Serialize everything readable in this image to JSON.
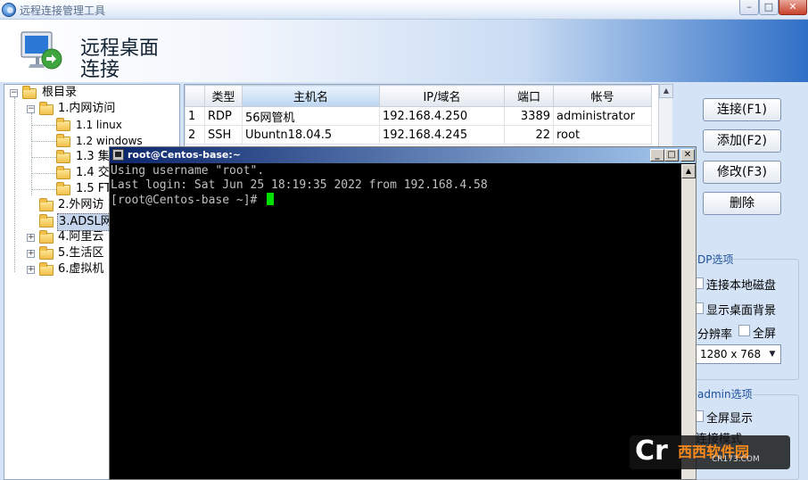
{
  "window": {
    "title": "远程连接管理工具",
    "min": "–",
    "max": "□",
    "close": "✕"
  },
  "banner": {
    "line1": "远程桌面",
    "line2": "连接"
  },
  "tree": {
    "root": "根目录",
    "nodes": [
      {
        "label": "1.内网访问",
        "expander": "−"
      },
      {
        "label": "1.1 linux"
      },
      {
        "label": "1.2 windows"
      },
      {
        "label": "1.3 集"
      },
      {
        "label": "1.4 交"
      },
      {
        "label": "1.5 FT"
      },
      {
        "label": "2.外网访"
      },
      {
        "label": "3.ADSL网"
      },
      {
        "label": "4.阿里云",
        "expander": "+"
      },
      {
        "label": "5.生活区",
        "expander": "+"
      },
      {
        "label": "6.虚拟机",
        "expander": "+"
      }
    ],
    "root_expander": "−"
  },
  "table": {
    "headers": [
      "",
      "类型",
      "主机名",
      "IP/域名",
      "端口",
      "帐号"
    ],
    "rows": [
      {
        "idx": "1",
        "type": "RDP",
        "host": "56网管机",
        "ip": "192.168.4.250",
        "port": "3389",
        "account": "administrator"
      },
      {
        "idx": "2",
        "type": "SSH",
        "host": "Ubuntn18.04.5",
        "ip": "192.168.4.245",
        "port": "22",
        "account": "root"
      }
    ]
  },
  "buttons": {
    "connect": "连接(F1)",
    "add": "添加(F2)",
    "modify": "修改(F3)",
    "delete": "删除"
  },
  "rdp_options": {
    "title": "DP选项",
    "local_disk": "连接本地磁盘",
    "show_bg": "显示桌面背景",
    "resolution_label": "分辨率",
    "fullscreen": "全屏",
    "resolution_value": "1280 x 768"
  },
  "admin_options": {
    "title": "admin选项",
    "fullscreen_display": "全屏显示",
    "mode_label": "连接模式"
  },
  "terminal": {
    "title": "root@Centos-base:~",
    "line1": "Using username \"root\".",
    "line2": "Last login: Sat Jun 25 18:19:35 2022 from 192.168.4.58",
    "line3": "[root@Centos-base ~]# "
  },
  "watermark": {
    "mark": "Cr",
    "text": "西西软件园",
    "site": "CR173.COM"
  },
  "colors": {
    "terminal_bg": "#000000",
    "terminal_fg": "#c0c0c0",
    "cursor": "#00e000",
    "accent": "#2f6fc6"
  }
}
